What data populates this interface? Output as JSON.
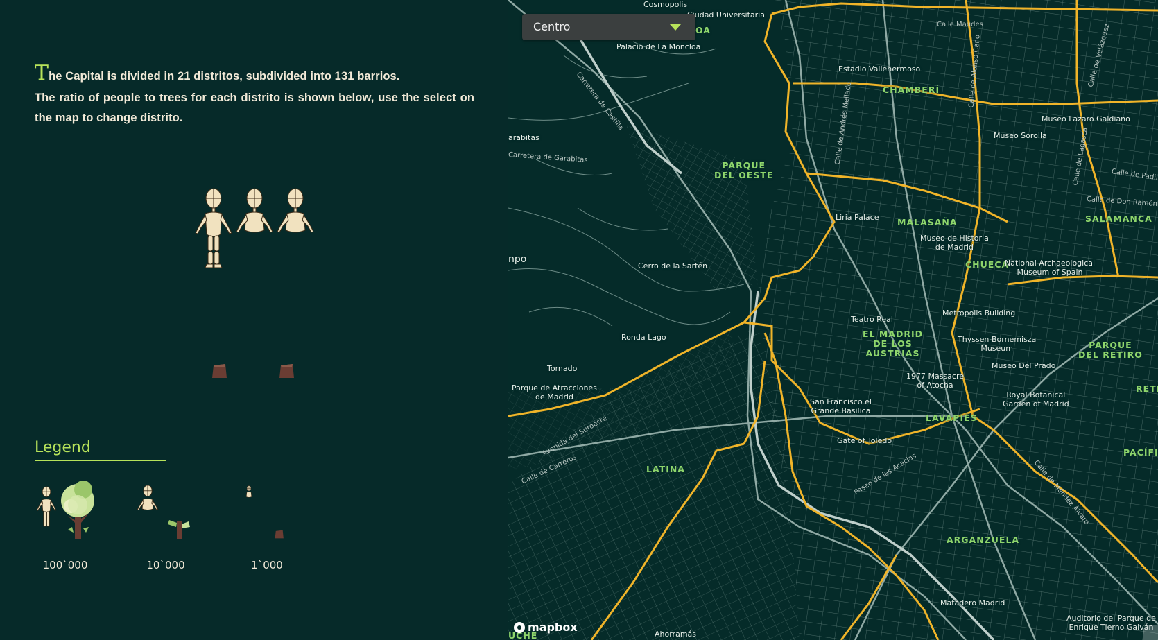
{
  "intro": {
    "drop_letter": "T",
    "line1_rest": "he Capital is divided in 21 distritos, subdivided into 131 barrios.",
    "line2": "The ratio of people to trees for each distrito is shown below, use the select on the map to change distrito."
  },
  "legend": {
    "title": "Legend",
    "items": [
      {
        "label": "100`000"
      },
      {
        "label": "10`000"
      },
      {
        "label": "1`000"
      }
    ]
  },
  "select": {
    "value": "Centro"
  },
  "map": {
    "attribution": "mapbox",
    "neighbourhoods": [
      {
        "name": "CHAMBERÍ"
      },
      {
        "name": "PARQUE\nDEL OESTE"
      },
      {
        "name": "MALASAÑA"
      },
      {
        "name": "SALAMANCA"
      },
      {
        "name": "CHUECA"
      },
      {
        "name": "EL MADRID\nDE LOS\nAUSTRIAS"
      },
      {
        "name": "PARQUE\nDEL RETIRO"
      },
      {
        "name": "LAVAPIÉS"
      },
      {
        "name": "LATINA"
      },
      {
        "name": "ARGANZUELA"
      },
      {
        "name": "OA"
      },
      {
        "name": "RETI"
      },
      {
        "name": "PACÍFIC"
      },
      {
        "name": "UCHE"
      }
    ],
    "places": [
      {
        "name": "Ciudad Universitaria"
      },
      {
        "name": "Palacio de La Moncloa"
      },
      {
        "name": "Estadio Vallehermoso"
      },
      {
        "name": "Museo Lazaro Galdiano"
      },
      {
        "name": "Museo Sorolla"
      },
      {
        "name": "arabitas"
      },
      {
        "name": "Liria Palace"
      },
      {
        "name": "Museo de Historia\nde Madrid"
      },
      {
        "name": "National Archaeological\nMuseum of Spain"
      },
      {
        "name": "npo"
      },
      {
        "name": "Cerro de la Sartén"
      },
      {
        "name": "Teatro Real"
      },
      {
        "name": "Metropolis Building"
      },
      {
        "name": "Thyssen-Bornemisza\nMuseum"
      },
      {
        "name": "Ronda Lago"
      },
      {
        "name": "Museo Del Prado"
      },
      {
        "name": "Tornado"
      },
      {
        "name": "1977 Massacre\nof Atocha"
      },
      {
        "name": "Parque de Atracciones\nde Madrid"
      },
      {
        "name": "San Francisco el\nGrande Basilica"
      },
      {
        "name": "Royal Botanical\nGarden of Madrid"
      },
      {
        "name": "Gate of Toledo"
      },
      {
        "name": "Matadero Madrid"
      },
      {
        "name": "Auditorio del Parque de\nEnrique Tierno Galván"
      },
      {
        "name": "Ahorramás"
      },
      {
        "name": "Cosmopolis"
      }
    ],
    "roads": [
      {
        "name": "Carretera de Castilla"
      },
      {
        "name": "Carretera de Garabitas"
      },
      {
        "name": "Calle Maudes"
      },
      {
        "name": "Calle de Velázquez"
      },
      {
        "name": "Calle de Padilla"
      },
      {
        "name": "Calle de Don Ramón de"
      },
      {
        "name": "Calle de Lagasca"
      },
      {
        "name": "Avenida del Suroeste"
      },
      {
        "name": "Calle de Carreros"
      },
      {
        "name": "Paseo de las Acacias"
      },
      {
        "name": "Calle de Méndez Álvaro"
      },
      {
        "name": "Calle de Andrés Mellado"
      },
      {
        "name": "Calle de Alonso Cano"
      }
    ]
  },
  "colors": {
    "background": "#062a29",
    "accent": "#b7e35a",
    "text": "#f2ead8",
    "district_border": "#f0b429",
    "map_roads": "#7d9a95",
    "neighbourhood_label": "#8fd66c",
    "select_bg": "#3b3f3f"
  },
  "icons": {
    "person": "wooden-mannequin-icon",
    "tree": "tree-icon",
    "stump": "tree-stump-icon",
    "dropdown": "chevron-down-icon"
  }
}
